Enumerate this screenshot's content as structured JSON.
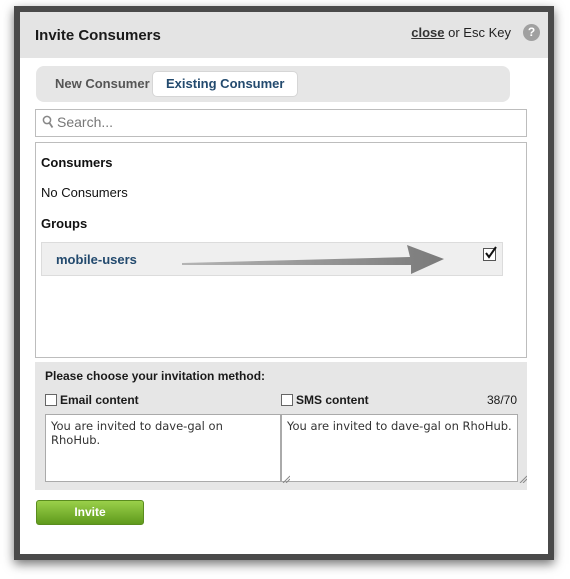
{
  "dialog": {
    "title": "Invite Consumers",
    "close_label": "close",
    "close_hint": "or Esc Key",
    "help_symbol": "?"
  },
  "tabs": [
    {
      "label": "New Consumer",
      "active": false
    },
    {
      "label": "Existing Consumer",
      "active": true
    }
  ],
  "search": {
    "placeholder": "Search...",
    "value": ""
  },
  "consumers": {
    "heading": "Consumers",
    "empty_text": "No Consumers"
  },
  "groups": {
    "heading": "Groups",
    "items": [
      {
        "name": "mobile-users",
        "checked": true
      }
    ]
  },
  "invitation": {
    "heading": "Please choose your invitation method:",
    "email_label": "Email content",
    "email_checked": false,
    "sms_label": "SMS content",
    "sms_checked": false,
    "char_count": "38/70",
    "email_text": "You are invited to dave-gal on RhoHub.",
    "sms_text": "You are invited to dave-gal on RhoHub."
  },
  "invite_button": "Invite",
  "colors": {
    "accent_text": "#234a6e",
    "invite_button": "#6fae26",
    "panel_bg": "#e6e6e6",
    "frame": "#4a4a4a"
  }
}
